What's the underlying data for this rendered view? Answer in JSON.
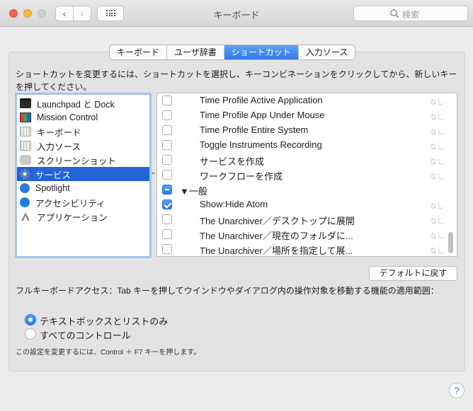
{
  "window": {
    "title": "キーボード",
    "search_placeholder": "検索",
    "nav_back": "‹",
    "nav_forward": "›"
  },
  "tabs": [
    {
      "label": "キーボード",
      "active": false
    },
    {
      "label": "ユーザ辞書",
      "active": false
    },
    {
      "label": "ショートカット",
      "active": true
    },
    {
      "label": "入力ソース",
      "active": false
    }
  ],
  "instructions": "ショートカットを変更するには、ショートカットを選択し、キーコンビネーションをクリックしてから、新しいキーを押してください。",
  "categories": [
    {
      "label": "Launchpad と Dock",
      "icon": "launchpad-dock-icon"
    },
    {
      "label": "Mission Control",
      "icon": "mission-control-icon"
    },
    {
      "label": "キーボード",
      "icon": "keyboard-icon"
    },
    {
      "label": "入力ソース",
      "icon": "input-source-icon"
    },
    {
      "label": "スクリーンショット",
      "icon": "screenshot-icon"
    },
    {
      "label": "サービス",
      "icon": "services-gear-icon",
      "selected": true
    },
    {
      "label": "Spotlight",
      "icon": "spotlight-icon"
    },
    {
      "label": "アクセシビリティ",
      "icon": "accessibility-icon"
    },
    {
      "label": "アプリケーション",
      "icon": "applications-icon"
    }
  ],
  "shortcuts": [
    {
      "label": "Time Profile Active Application",
      "checked": false,
      "key": "なし"
    },
    {
      "label": "Time Profile App Under Mouse",
      "checked": false,
      "key": "なし"
    },
    {
      "label": "Time Profile Entire System",
      "checked": false,
      "key": "なし"
    },
    {
      "label": "Toggle Instruments Recording",
      "checked": false,
      "key": "なし"
    },
    {
      "label": "サービスを作成",
      "checked": false,
      "key": "なし"
    },
    {
      "label": "ワークフローを作成",
      "checked": false,
      "key": "なし"
    },
    {
      "label": "▼一般",
      "checked": "mixed",
      "key": "",
      "group": true
    },
    {
      "label": "Show:Hide Atom",
      "checked": true,
      "key": "なし"
    },
    {
      "label": "The Unarchiver／デスクトップに展開",
      "checked": false,
      "key": "なし"
    },
    {
      "label": "The Unarchiver／現在のフォルダに...",
      "checked": false,
      "key": "なし"
    },
    {
      "label": "The Unarchiver／場所を指定して展...",
      "checked": false,
      "key": "なし"
    }
  ],
  "default_button": "デフォルトに戻す",
  "full_keyboard_access": "フルキーボードアクセス：Tab キーを押してウインドウやダイアログ内の操作対象を移動する機能の適用範囲：",
  "radio_options": [
    {
      "label": "テキストボックスとリストのみ",
      "selected": true
    },
    {
      "label": "すべてのコントロール",
      "selected": false
    }
  ],
  "note": "この設定を変更するには、Control ＋ F7 キーを押します。",
  "help": "?"
}
